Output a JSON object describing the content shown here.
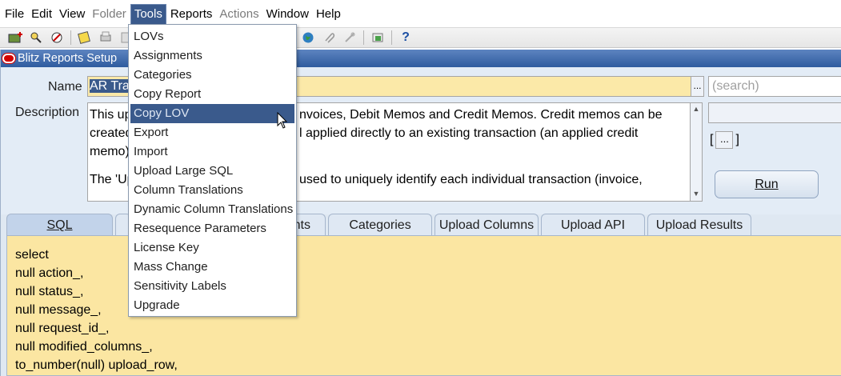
{
  "menubar": [
    {
      "label": "File",
      "state": "normal"
    },
    {
      "label": "Edit",
      "state": "normal"
    },
    {
      "label": "View",
      "state": "normal"
    },
    {
      "label": "Folder",
      "state": "disabled"
    },
    {
      "label": "Tools",
      "state": "active"
    },
    {
      "label": "Reports",
      "state": "normal"
    },
    {
      "label": "Actions",
      "state": "disabled"
    },
    {
      "label": "Window",
      "state": "normal"
    },
    {
      "label": "Help",
      "state": "normal"
    }
  ],
  "toolbar_icons": [
    "new-record-icon",
    "find-icon",
    "navigator-icon",
    "save-icon",
    "print-icon",
    "close-form-icon",
    "cut-icon",
    "copy-icon",
    "paste-icon",
    "edit-field-icon",
    "zoom-icon",
    "translations-icon",
    "attachments-icon",
    "folder-tools-icon",
    "window-icon",
    "help-icon"
  ],
  "window": {
    "title": "Blitz Reports Setup",
    "name_label": "Name",
    "name_value_selected": "AR Tra",
    "description_label": "Description",
    "description_lines": [
      "This up",
      "created",
      "memo)"
    ],
    "description_lines_right": [
      "nvoices, Debit Memos and Credit Memos. Credit memos can be",
      "l applied directly to an existing transaction (an applied credit",
      ""
    ],
    "description_para2_left": "The 'Up",
    "description_para2_right": "used to uniquely identify each individual transaction (invoice,",
    "search_placeholder": "(search)",
    "bracket_open": "[",
    "bracket_dots": "...",
    "bracket_close": "]",
    "run_label": "Run",
    "lov_label": "..."
  },
  "tabs": [
    {
      "label": "SQL",
      "active": true
    },
    {
      "label": "",
      "active": false
    },
    {
      "label": "nts",
      "active": false
    },
    {
      "label": "Categories",
      "active": false
    },
    {
      "label": "Upload Columns",
      "active": false
    },
    {
      "label": "Upload API",
      "active": false
    },
    {
      "label": "Upload Results",
      "active": false
    }
  ],
  "sql_lines": [
    "select",
    "null action_,",
    "null status_,",
    "null message_,",
    "null request_id_,",
    "null modified_columns_,",
    "to_number(null) upload_row,"
  ],
  "tools_menu": [
    {
      "label": "LOVs",
      "highlighted": false
    },
    {
      "label": "Assignments",
      "highlighted": false
    },
    {
      "label": "Categories",
      "highlighted": false
    },
    {
      "label": "Copy Report",
      "highlighted": false
    },
    {
      "label": "Copy LOV",
      "highlighted": true
    },
    {
      "label": "Export",
      "highlighted": false
    },
    {
      "label": "Import",
      "highlighted": false
    },
    {
      "label": "Upload Large SQL",
      "highlighted": false
    },
    {
      "label": "Column Translations",
      "highlighted": false
    },
    {
      "label": "Dynamic Column Translations",
      "highlighted": false
    },
    {
      "label": "Resequence Parameters",
      "highlighted": false
    },
    {
      "label": "License Key",
      "highlighted": false
    },
    {
      "label": "Mass Change",
      "highlighted": false
    },
    {
      "label": "Sensitivity Labels",
      "highlighted": false
    },
    {
      "label": "Upgrade",
      "highlighted": false
    }
  ]
}
